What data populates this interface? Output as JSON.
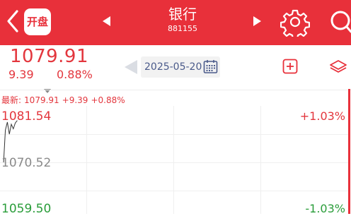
{
  "header": {
    "title": "银行",
    "code": "881155",
    "badge_label": "开盘",
    "bg_color": "#e8303a"
  },
  "icons": {
    "back": "back-chevron-icon",
    "prev": "prev-triangle-icon",
    "next": "next-triangle-icon",
    "settings": "gear-icon",
    "search": "search-icon",
    "calendar": "calendar-icon",
    "add": "add-square-icon",
    "layers": "layers-icon",
    "expand": "caret-down-icon"
  },
  "quote": {
    "price": "1079.91",
    "change": "9.39",
    "change_pct": "0.88%",
    "color": "#e3363d"
  },
  "date_picker": {
    "date": "2025-05-20"
  },
  "chart": {
    "latest_prefix": "最新:",
    "latest_price": "1079.91",
    "latest_change": "+9.39",
    "latest_pct": "+0.88%",
    "y_labels": [
      "1081.54",
      "1070.52",
      "1059.50"
    ],
    "pct_labels": [
      "+1.03%",
      "-1.03%"
    ],
    "up_color": "#e3363d",
    "down_color": "#2a9d3a"
  },
  "chart_data": {
    "type": "line",
    "title": "",
    "ylim": [
      1059.5,
      1081.54
    ],
    "reference": 1070.52,
    "x": [
      0,
      1,
      2,
      3,
      4,
      5,
      6,
      7,
      8
    ],
    "values": [
      1060.9,
      1069.0,
      1077.6,
      1079.5,
      1076.6,
      1079.0,
      1077.9,
      1079.3,
      1079.9
    ]
  }
}
